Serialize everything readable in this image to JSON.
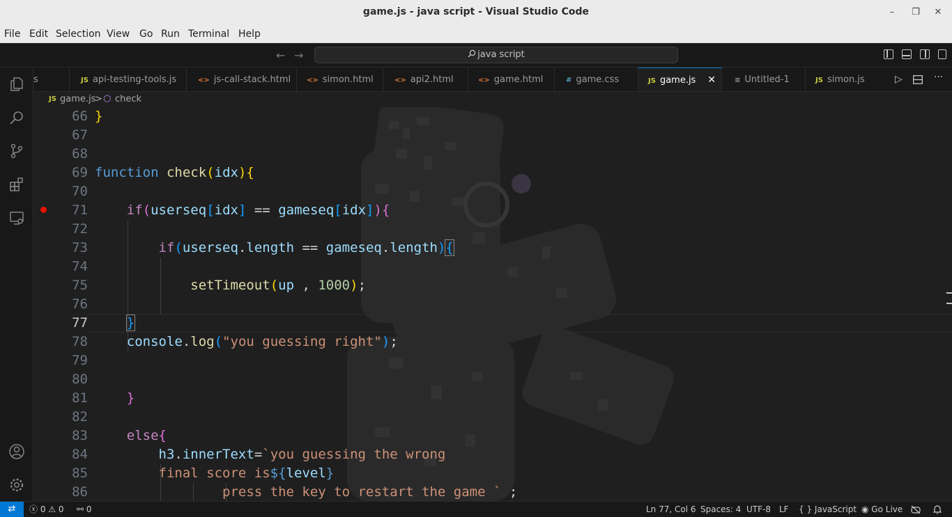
{
  "window": {
    "title": "game.js - java script - Visual Studio Code",
    "minimize": "–",
    "maximize": "❐",
    "close": "✕"
  },
  "menu": [
    "File",
    "Edit",
    "Selection",
    "View",
    "Go",
    "Run",
    "Terminal",
    "Help"
  ],
  "command_center": {
    "search_text": "java script",
    "back": "←",
    "forward": "→"
  },
  "tabs": [
    {
      "label": "s",
      "icon": "",
      "type": "js"
    },
    {
      "label": "api-testing-tools.js",
      "icon": "JS",
      "type": "js"
    },
    {
      "label": "js-call-stack.html",
      "icon": "<>",
      "type": "html"
    },
    {
      "label": "simon.html",
      "icon": "<>",
      "type": "html"
    },
    {
      "label": "api2.html",
      "icon": "<>",
      "type": "html"
    },
    {
      "label": "game.html",
      "icon": "<>",
      "type": "html"
    },
    {
      "label": "game.css",
      "icon": "#",
      "type": "css"
    },
    {
      "label": "game.js",
      "icon": "JS",
      "type": "js",
      "active": true
    },
    {
      "label": "Untitled-1",
      "icon": "≡",
      "type": "txt"
    },
    {
      "label": "simon.js",
      "icon": "JS",
      "type": "js"
    }
  ],
  "breadcrumb": {
    "file_icon": "JS",
    "file": "game.js",
    "separator": ">",
    "symbol_icon": "⬡",
    "symbol": "check"
  },
  "editor": {
    "line_numbers": [
      "66",
      "67",
      "68",
      "69",
      "70",
      "71",
      "72",
      "73",
      "74",
      "75",
      "76",
      "77",
      "78",
      "79",
      "80",
      "81",
      "82",
      "83",
      "84",
      "85",
      "86"
    ],
    "current_line": "77",
    "breakpoint_line": "71",
    "tokens": {
      "l66_close": "}",
      "l69_function": "function",
      "l69_name": "check",
      "l69_open": "(",
      "l69_param": "idx",
      "l69_close": ")",
      "l69_brace": "{",
      "l71_if": "if",
      "l71_open": "(",
      "l71_userseq": "userseq",
      "l71_b1": "[",
      "l71_idx1": "idx",
      "l71_b2": "]",
      "l71_eq": " == ",
      "l71_gameseq": "gameseq",
      "l71_b3": "[",
      "l71_idx2": "idx",
      "l71_b4": "]",
      "l71_close": ")",
      "l71_brace": "{",
      "l73_if": "if",
      "l73_open": "(",
      "l73_userseq": "userseq",
      "l73_dot1": ".",
      "l73_length1": "length",
      "l73_eq": " == ",
      "l73_gameseq": "gameseq",
      "l73_dot2": ".",
      "l73_length2": "length",
      "l73_close": ")",
      "l73_brace": "{",
      "l75_fn": "setTimeout",
      "l75_open": "(",
      "l75_arg": "up",
      "l75_comma": " , ",
      "l75_num": "1000",
      "l75_close": ")",
      "l75_semi": ";",
      "l77_brace": "}",
      "l78_console": "console",
      "l78_dot": ".",
      "l78_log": "log",
      "l78_open": "(",
      "l78_str": "\"you guessing right\"",
      "l78_close": ")",
      "l78_semi": ";",
      "l81_brace": "}",
      "l83_else": "else",
      "l83_brace": "{",
      "l84_h3": "h3",
      "l84_dot": ".",
      "l84_inner": "innerText",
      "l84_eq": "=",
      "l84_str": "`you guessing the wrong",
      "l85_str": "final score is",
      "l85_interp": "${",
      "l85_var": "level",
      "l85_interp_close": "}",
      "l86_str": "press the key to restart the game `",
      "l86_semi": " ;"
    }
  },
  "statusbar": {
    "remote_icon": "⇄",
    "errors": "0",
    "warnings": "0",
    "ports": "0",
    "position": "Ln 77, Col 6",
    "spaces": "Spaces: 4",
    "encoding": "UTF-8",
    "eol": "LF",
    "language_icon": "{ }",
    "language": "JavaScript",
    "golive": "Go Live"
  },
  "colors": {
    "accent": "#0078d4",
    "breakpoint": "#e51400"
  }
}
